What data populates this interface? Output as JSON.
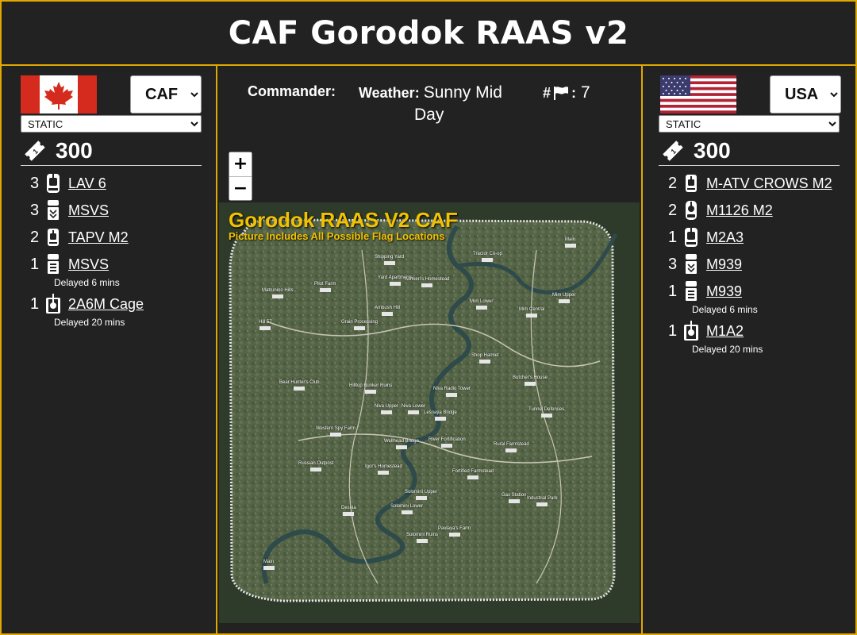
{
  "header": {
    "title": "CAF Gorodok RAAS v2"
  },
  "left": {
    "faction": "CAF",
    "mode": "STATIC",
    "tickets": "300",
    "vehicles": [
      {
        "count": "3",
        "name": "LAV 6",
        "icon": "ifv-icon",
        "delay": ""
      },
      {
        "count": "3",
        "name": "MSVS",
        "icon": "logistics-truck-icon",
        "delay": ""
      },
      {
        "count": "2",
        "name": "TAPV M2",
        "icon": "armored-car-icon",
        "delay": ""
      },
      {
        "count": "1",
        "name": "MSVS",
        "icon": "transport-truck-icon",
        "delay": "Delayed 6 mins"
      },
      {
        "count": "1",
        "name": "2A6M Cage",
        "icon": "tank-icon",
        "delay": "Delayed 20 mins"
      }
    ]
  },
  "right": {
    "faction": "USA",
    "mode": "STATIC",
    "tickets": "300",
    "vehicles": [
      {
        "count": "2",
        "name": "M-ATV CROWS M2",
        "icon": "armored-car-icon",
        "delay": ""
      },
      {
        "count": "2",
        "name": "M1126 M2",
        "icon": "apc-icon",
        "delay": ""
      },
      {
        "count": "1",
        "name": "M2A3",
        "icon": "ifv-icon",
        "delay": ""
      },
      {
        "count": "3",
        "name": "M939",
        "icon": "logistics-truck-icon",
        "delay": ""
      },
      {
        "count": "1",
        "name": "M939",
        "icon": "transport-truck-icon",
        "delay": "Delayed 6 mins"
      },
      {
        "count": "1",
        "name": "M1A2",
        "icon": "tank-icon",
        "delay": "Delayed 20 mins"
      }
    ]
  },
  "info": {
    "commander_label": "Commander:",
    "weather_label": "Weather:",
    "weather_value_1": "Sunny Mid",
    "weather_value_2": "Day",
    "flags_hash": "#",
    "flags_colon": ":",
    "flags_count": "7"
  },
  "zoom": {
    "in": "+",
    "out": "−"
  },
  "map": {
    "title": "Gorodok RAAS V2 CAF",
    "subtitle": "Picture Includes All Possible Flag Locations",
    "labels": [
      "Main",
      "Shipping Yard",
      "Tractor Co-op",
      "Matrunino Hills",
      "Pilot Farm",
      "Yard Apartments",
      "Ashkeri's Homestead",
      "Mim Lower",
      "Mim Central",
      "Mim Upper",
      "Hill 57",
      "Ambush Hill",
      "Grain Processing",
      "Shop Hamlet",
      "Butcher's House",
      "Bear Hunter's Club",
      "Hilltop Bunker Ruins",
      "Niva Radio Tower",
      "Niva Upper",
      "Niva Lower",
      "Lesnaya Bridge",
      "Tunnel Defenses",
      "Western Spy Farm",
      "Wellhead Bridge",
      "River Fortification",
      "Rural Farmstead",
      "Russian Outpost",
      "Igor's Homestead",
      "Fortified Farmstead",
      "Solomini Upper",
      "Gas Station",
      "Industrial Park",
      "Desnia",
      "Solomini Lower",
      "Pavlaya's Farm",
      "Solomini Ruins",
      "Main"
    ],
    "colors": {
      "title": "#f2c200",
      "river": "#2f4a4a",
      "terrain": "#59684a"
    }
  },
  "colors": {
    "accent": "#e0a800",
    "panel": "#222222"
  }
}
